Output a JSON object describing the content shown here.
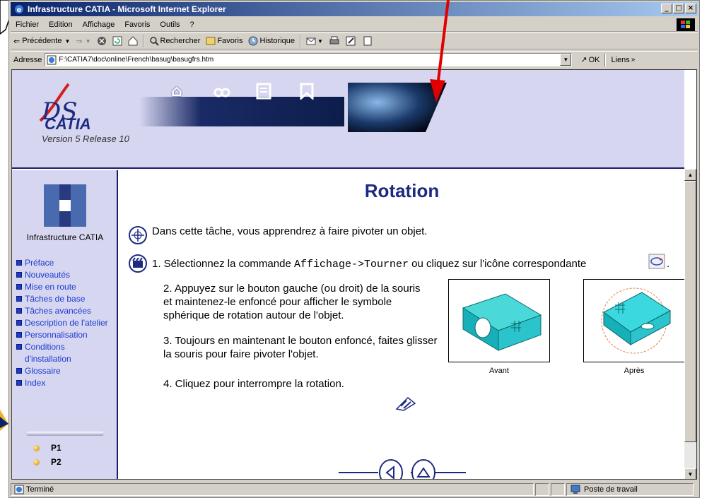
{
  "window": {
    "title": "Infrastructure CATIA - Microsoft Internet Explorer"
  },
  "menu": [
    "Fichier",
    "Edition",
    "Affichage",
    "Favoris",
    "Outils",
    "?"
  ],
  "toolbar": {
    "back": "Précédente",
    "search": "Rechercher",
    "favorites": "Favoris",
    "history": "Historique"
  },
  "address": {
    "label": "Adresse",
    "value": "F:\\CATIA7\\doc\\online\\French\\basug\\basugfrs.htm",
    "ok": "OK",
    "links": "Liens"
  },
  "banner": {
    "brand": "CATIA",
    "version": "Version 5 Release 10"
  },
  "sidebar": {
    "title": "Infrastructure CATIA",
    "links": [
      "Préface",
      "Nouveautés",
      "Mise en route",
      "Tâches de base",
      "Tâches avancées",
      "Description de l'atelier",
      "Personnalisation",
      "Conditions d'installation",
      "Glossaire",
      "Index"
    ],
    "pages": [
      "P1",
      "P2"
    ]
  },
  "page": {
    "title": "Rotation",
    "intro": "Dans cette tâche, vous apprendrez à faire pivoter un objet.",
    "step1_pre": "1. Sélectionnez la commande ",
    "step1_cmd": "Affichage->Tourner",
    "step1_post": " ou cliquez sur l'icône correspondante",
    "step2": "2. Appuyez sur le bouton gauche (ou droit) de la souris et maintenez-le enfoncé pour afficher le symbole sphérique de rotation autour de l'objet.",
    "step3": "3. Toujours en maintenant le bouton enfoncé, faites glisser la souris pour faire pivoter l'objet.",
    "step4": "4. Cliquez pour interrompre la rotation.",
    "before": "Avant",
    "after": "Après",
    "step1_trailing": "."
  },
  "status": {
    "text": "Terminé",
    "zone": "Poste de travail"
  },
  "colors": {
    "accent": "#1d2a80",
    "link": "#1a3ad0",
    "panel": "#d6d6f0",
    "titlebar": "#0a246a"
  }
}
